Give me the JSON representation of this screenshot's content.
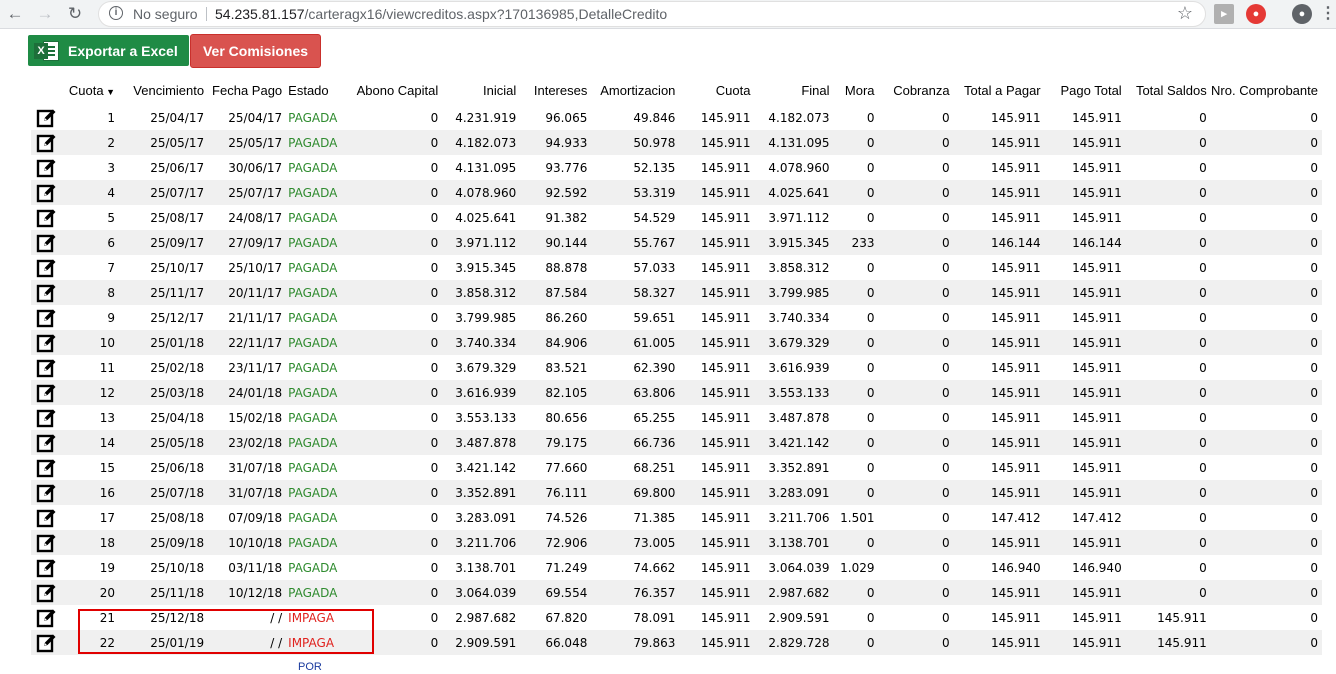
{
  "browser": {
    "security_label": "No seguro",
    "url_host": "54.235.81.157",
    "url_path": "/carteragx16/viewcreditos.aspx?170136985,DetalleCredito"
  },
  "toolbar": {
    "excel_label": "Exportar a Excel",
    "comisiones_label": "Ver Comisiones"
  },
  "table": {
    "headers": [
      "Cuota",
      "Vencimiento",
      "Fecha Pago",
      "Estado",
      "Abono Capital",
      "Inicial",
      "Intereses",
      "Amortizacion",
      "Cuota",
      "Final",
      "Mora",
      "Cobranza",
      "Total a Pagar",
      "Pago Total",
      "Total Saldos",
      "Nro. Comprobante"
    ],
    "rows": [
      [
        "1",
        "25/04/17",
        "25/04/17",
        "PAGADA",
        "0",
        "4.231.919",
        "96.065",
        "49.846",
        "145.911",
        "4.182.073",
        "0",
        "0",
        "145.911",
        "145.911",
        "0",
        "0"
      ],
      [
        "2",
        "25/05/17",
        "25/05/17",
        "PAGADA",
        "0",
        "4.182.073",
        "94.933",
        "50.978",
        "145.911",
        "4.131.095",
        "0",
        "0",
        "145.911",
        "145.911",
        "0",
        "0"
      ],
      [
        "3",
        "25/06/17",
        "30/06/17",
        "PAGADA",
        "0",
        "4.131.095",
        "93.776",
        "52.135",
        "145.911",
        "4.078.960",
        "0",
        "0",
        "145.911",
        "145.911",
        "0",
        "0"
      ],
      [
        "4",
        "25/07/17",
        "25/07/17",
        "PAGADA",
        "0",
        "4.078.960",
        "92.592",
        "53.319",
        "145.911",
        "4.025.641",
        "0",
        "0",
        "145.911",
        "145.911",
        "0",
        "0"
      ],
      [
        "5",
        "25/08/17",
        "24/08/17",
        "PAGADA",
        "0",
        "4.025.641",
        "91.382",
        "54.529",
        "145.911",
        "3.971.112",
        "0",
        "0",
        "145.911",
        "145.911",
        "0",
        "0"
      ],
      [
        "6",
        "25/09/17",
        "27/09/17",
        "PAGADA",
        "0",
        "3.971.112",
        "90.144",
        "55.767",
        "145.911",
        "3.915.345",
        "233",
        "0",
        "146.144",
        "146.144",
        "0",
        "0"
      ],
      [
        "7",
        "25/10/17",
        "25/10/17",
        "PAGADA",
        "0",
        "3.915.345",
        "88.878",
        "57.033",
        "145.911",
        "3.858.312",
        "0",
        "0",
        "145.911",
        "145.911",
        "0",
        "0"
      ],
      [
        "8",
        "25/11/17",
        "20/11/17",
        "PAGADA",
        "0",
        "3.858.312",
        "87.584",
        "58.327",
        "145.911",
        "3.799.985",
        "0",
        "0",
        "145.911",
        "145.911",
        "0",
        "0"
      ],
      [
        "9",
        "25/12/17",
        "21/11/17",
        "PAGADA",
        "0",
        "3.799.985",
        "86.260",
        "59.651",
        "145.911",
        "3.740.334",
        "0",
        "0",
        "145.911",
        "145.911",
        "0",
        "0"
      ],
      [
        "10",
        "25/01/18",
        "22/11/17",
        "PAGADA",
        "0",
        "3.740.334",
        "84.906",
        "61.005",
        "145.911",
        "3.679.329",
        "0",
        "0",
        "145.911",
        "145.911",
        "0",
        "0"
      ],
      [
        "11",
        "25/02/18",
        "23/11/17",
        "PAGADA",
        "0",
        "3.679.329",
        "83.521",
        "62.390",
        "145.911",
        "3.616.939",
        "0",
        "0",
        "145.911",
        "145.911",
        "0",
        "0"
      ],
      [
        "12",
        "25/03/18",
        "24/01/18",
        "PAGADA",
        "0",
        "3.616.939",
        "82.105",
        "63.806",
        "145.911",
        "3.553.133",
        "0",
        "0",
        "145.911",
        "145.911",
        "0",
        "0"
      ],
      [
        "13",
        "25/04/18",
        "15/02/18",
        "PAGADA",
        "0",
        "3.553.133",
        "80.656",
        "65.255",
        "145.911",
        "3.487.878",
        "0",
        "0",
        "145.911",
        "145.911",
        "0",
        "0"
      ],
      [
        "14",
        "25/05/18",
        "23/02/18",
        "PAGADA",
        "0",
        "3.487.878",
        "79.175",
        "66.736",
        "145.911",
        "3.421.142",
        "0",
        "0",
        "145.911",
        "145.911",
        "0",
        "0"
      ],
      [
        "15",
        "25/06/18",
        "31/07/18",
        "PAGADA",
        "0",
        "3.421.142",
        "77.660",
        "68.251",
        "145.911",
        "3.352.891",
        "0",
        "0",
        "145.911",
        "145.911",
        "0",
        "0"
      ],
      [
        "16",
        "25/07/18",
        "31/07/18",
        "PAGADA",
        "0",
        "3.352.891",
        "76.111",
        "69.800",
        "145.911",
        "3.283.091",
        "0",
        "0",
        "145.911",
        "145.911",
        "0",
        "0"
      ],
      [
        "17",
        "25/08/18",
        "07/09/18",
        "PAGADA",
        "0",
        "3.283.091",
        "74.526",
        "71.385",
        "145.911",
        "3.211.706",
        "1.501",
        "0",
        "147.412",
        "147.412",
        "0",
        "0"
      ],
      [
        "18",
        "25/09/18",
        "10/10/18",
        "PAGADA",
        "0",
        "3.211.706",
        "72.906",
        "73.005",
        "145.911",
        "3.138.701",
        "0",
        "0",
        "145.911",
        "145.911",
        "0",
        "0"
      ],
      [
        "19",
        "25/10/18",
        "03/11/18",
        "PAGADA",
        "0",
        "3.138.701",
        "71.249",
        "74.662",
        "145.911",
        "3.064.039",
        "1.029",
        "0",
        "146.940",
        "146.940",
        "0",
        "0"
      ],
      [
        "20",
        "25/11/18",
        "10/12/18",
        "PAGADA",
        "0",
        "3.064.039",
        "69.554",
        "76.357",
        "145.911",
        "2.987.682",
        "0",
        "0",
        "145.911",
        "145.911",
        "0",
        "0"
      ],
      [
        "21",
        "25/12/18",
        "/ /",
        "IMPAGA",
        "0",
        "2.987.682",
        "67.820",
        "78.091",
        "145.911",
        "2.909.591",
        "0",
        "0",
        "145.911",
        "145.911",
        "145.911",
        "0"
      ],
      [
        "22",
        "25/01/19",
        "/ /",
        "IMPAGA",
        "0",
        "2.909.591",
        "66.048",
        "79.863",
        "145.911",
        "2.829.728",
        "0",
        "0",
        "145.911",
        "145.911",
        "145.911",
        "0"
      ]
    ]
  },
  "footer_partial": "POR",
  "colors": {
    "paid": "#2e8b2e",
    "unpaid": "#e0221e",
    "excel": "#1f8b45",
    "comisiones": "#d9534f",
    "highlight": "#e00000"
  },
  "icons": {
    "row_action": "edit-icon",
    "excel": "excel-icon"
  }
}
